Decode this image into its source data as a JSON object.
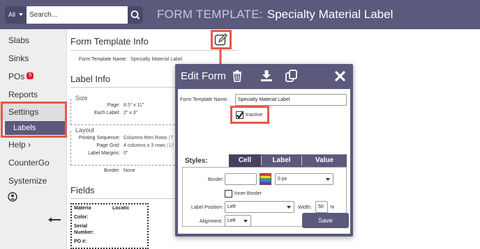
{
  "header": {
    "search_scope": "All",
    "search_placeholder": "Search...",
    "title_label": "FORM TEMPLATE:",
    "title_value": "Specialty Material Label"
  },
  "sidebar": {
    "items": [
      {
        "label": "Slabs"
      },
      {
        "label": "Sinks"
      },
      {
        "label": "POs",
        "badge": "5"
      },
      {
        "label": "Reports"
      },
      {
        "label": "Settings"
      },
      {
        "label": "Labels"
      },
      {
        "label": "Help ›"
      },
      {
        "label": "CounterGo"
      },
      {
        "label": "Systemize"
      }
    ]
  },
  "form_template_info": {
    "title": "Form Template Info",
    "name_label": "Form Template Name:",
    "name_value": "Specialty Material Label"
  },
  "label_info": {
    "title": "Label Info",
    "size_title": "Size",
    "page_label": "Page:",
    "page_value": "8.5\" x 11\"",
    "each_label": "Each Label:",
    "each_value": "2\" x 3\"",
    "layout_title": "Layout",
    "seq_label": "Printing Sequence:",
    "seq_value": "Columns then Rows",
    "seq_extra": "(T",
    "grid_label": "Page Grid:",
    "grid_value": "4 columns x 3 rows",
    "grid_extra": "(12",
    "margins_label": "Label Margins:",
    "margins_value": "0\"",
    "border_label": "Border:",
    "border_value": "None"
  },
  "fields": {
    "title": "Fields",
    "preview_lines": [
      "Materia",
      "Locatic",
      "Color:",
      "Serial",
      "Number:",
      "PO #:"
    ]
  },
  "modal": {
    "title": "Edit Form",
    "name_label": "Form Template Name:",
    "name_value": "Specialty Material Label",
    "inactive_label": "Inactive",
    "inactive_checked": true,
    "styles_label": "Styles:",
    "tabs": [
      "Cell",
      "Label",
      "Value"
    ],
    "selected_tab": "Cell",
    "border_label": "Border:",
    "border_width": "0 px",
    "inner_border_label": "Inner Border",
    "label_position_label": "Label Position:",
    "label_position_value": "Left",
    "width_label": "Width:",
    "width_value": "50",
    "width_unit": "%",
    "alignment_label": "Alignment:",
    "alignment_value": "Left",
    "save_label": "Save"
  },
  "colors": {
    "brand": "#5b5a7c",
    "highlight": "#e8584a",
    "badge": "#d9232d"
  }
}
